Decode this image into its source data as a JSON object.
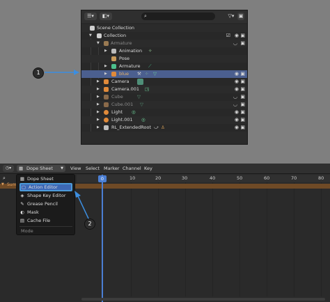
{
  "outliner": {
    "header": {
      "editor_icon": "outliner-icon",
      "filter_icon": "filter-icon"
    },
    "rows": [
      {
        "label": "Scene Collection"
      },
      {
        "label": "Collection"
      },
      {
        "label": "Armature"
      },
      {
        "label": "Animation"
      },
      {
        "label": "Pose"
      },
      {
        "label": "Armature"
      },
      {
        "label": "blue"
      },
      {
        "label": "Camera"
      },
      {
        "label": "Camera.001"
      },
      {
        "label": "Cube"
      },
      {
        "label": "Cube.001"
      },
      {
        "label": "Light"
      },
      {
        "label": "Light.001"
      },
      {
        "label": "RL_ExtendedRoot"
      }
    ]
  },
  "callouts": {
    "one": "1",
    "two": "2"
  },
  "dope": {
    "mode_label": "Dope Sheet",
    "menus": [
      "View",
      "Select",
      "Marker",
      "Channel",
      "Key"
    ],
    "current_frame": "0",
    "ticks": [
      "0",
      "10",
      "20",
      "30",
      "40",
      "50",
      "60",
      "70",
      "80",
      "90",
      "100"
    ],
    "summary_label": "Sum"
  },
  "dropdown": {
    "items": [
      {
        "label": "Dope Sheet",
        "icon": "dope-sheet-icon"
      },
      {
        "label": "Action Editor",
        "icon": "action-editor-icon",
        "active": true
      },
      {
        "label": "Shape Key Editor",
        "icon": "shape-key-icon"
      },
      {
        "label": "Grease Pencil",
        "icon": "grease-pencil-icon"
      },
      {
        "label": "Mask",
        "icon": "mask-icon"
      },
      {
        "label": "Cache File",
        "icon": "cache-file-icon"
      }
    ],
    "section_label": "Mode"
  },
  "colors": {
    "accent": "#4b7fd4",
    "selected_row": "#4b5f8f",
    "summary": "#6f4a26"
  }
}
